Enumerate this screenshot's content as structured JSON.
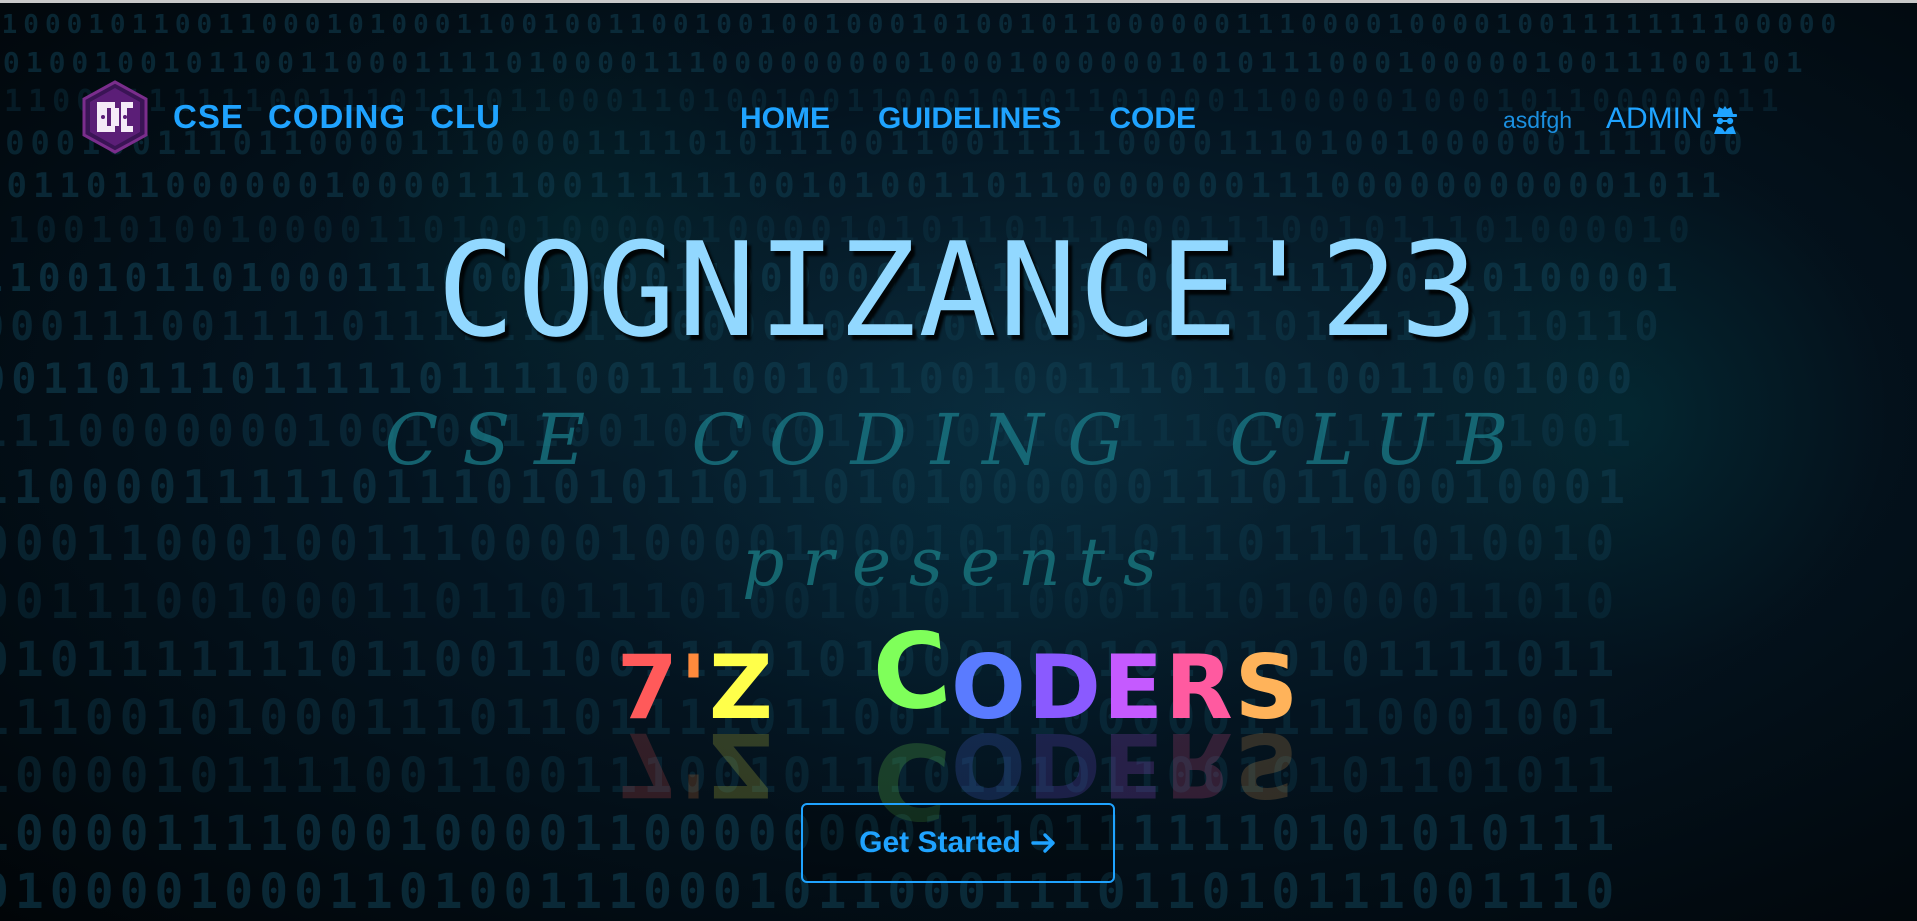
{
  "navbar": {
    "brand": "CSE CODING CLUB",
    "links": [
      {
        "label": "HOME"
      },
      {
        "label": "GUIDELINES"
      },
      {
        "label": "CODE"
      }
    ],
    "user_name": "asdfgh",
    "admin_label": "ADMIN",
    "admin_icon": "spy-icon"
  },
  "hero": {
    "title": "COGNIZANCE'23",
    "club_line": "CSE CODING CLUB",
    "presents": "presents",
    "event_name_letters": [
      {
        "char": "7",
        "color": "#ff5a5a"
      },
      {
        "char": "'",
        "color": "#ff8a3c"
      },
      {
        "char": "Z",
        "color": "#ffff4a"
      },
      {
        "char": " ",
        "color": "#ffffff"
      },
      {
        "char": "C",
        "color": "#7fff5a"
      },
      {
        "char": "O",
        "color": "#5a7bff"
      },
      {
        "char": "D",
        "color": "#8a5aff"
      },
      {
        "char": "E",
        "color": "#c55aff"
      },
      {
        "char": "R",
        "color": "#ff5aa0"
      },
      {
        "char": "S",
        "color": "#ffb35a"
      }
    ],
    "cta_label": "Get Started",
    "cta_icon": "arrow-right-icon"
  },
  "colors": {
    "accent": "#1fa3ff",
    "title": "#92d8ff",
    "teal_sub": "#1b7f8c"
  }
}
